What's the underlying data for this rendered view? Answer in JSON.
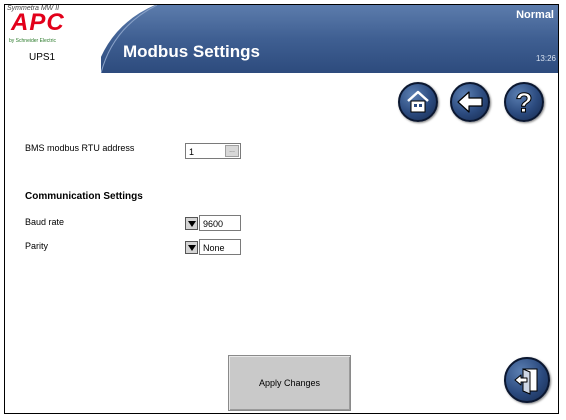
{
  "header": {
    "product_name": "Symmetra MW II",
    "brand": "APC",
    "sub_brand": "by Schneider Electric",
    "device": "UPS1",
    "title": "Modbus Settings",
    "status": "Normal",
    "time": "13:26"
  },
  "nav": {
    "home_icon": "home-icon",
    "back_icon": "back-arrow-icon",
    "help_icon": "help-icon",
    "logout_icon": "exit-door-icon"
  },
  "form": {
    "bms_address": {
      "label": "BMS modbus RTU address",
      "value": "1",
      "button": "..."
    },
    "communication_title": "Communication Settings",
    "baud_rate": {
      "label": "Baud rate",
      "value": "9600"
    },
    "parity": {
      "label": "Parity",
      "value": "None"
    }
  },
  "actions": {
    "apply_label": "Apply Changes"
  },
  "colors": {
    "header_blue": "#3a5a8f",
    "button_gray": "#c9c9c9",
    "brand_red": "#e2001a"
  }
}
